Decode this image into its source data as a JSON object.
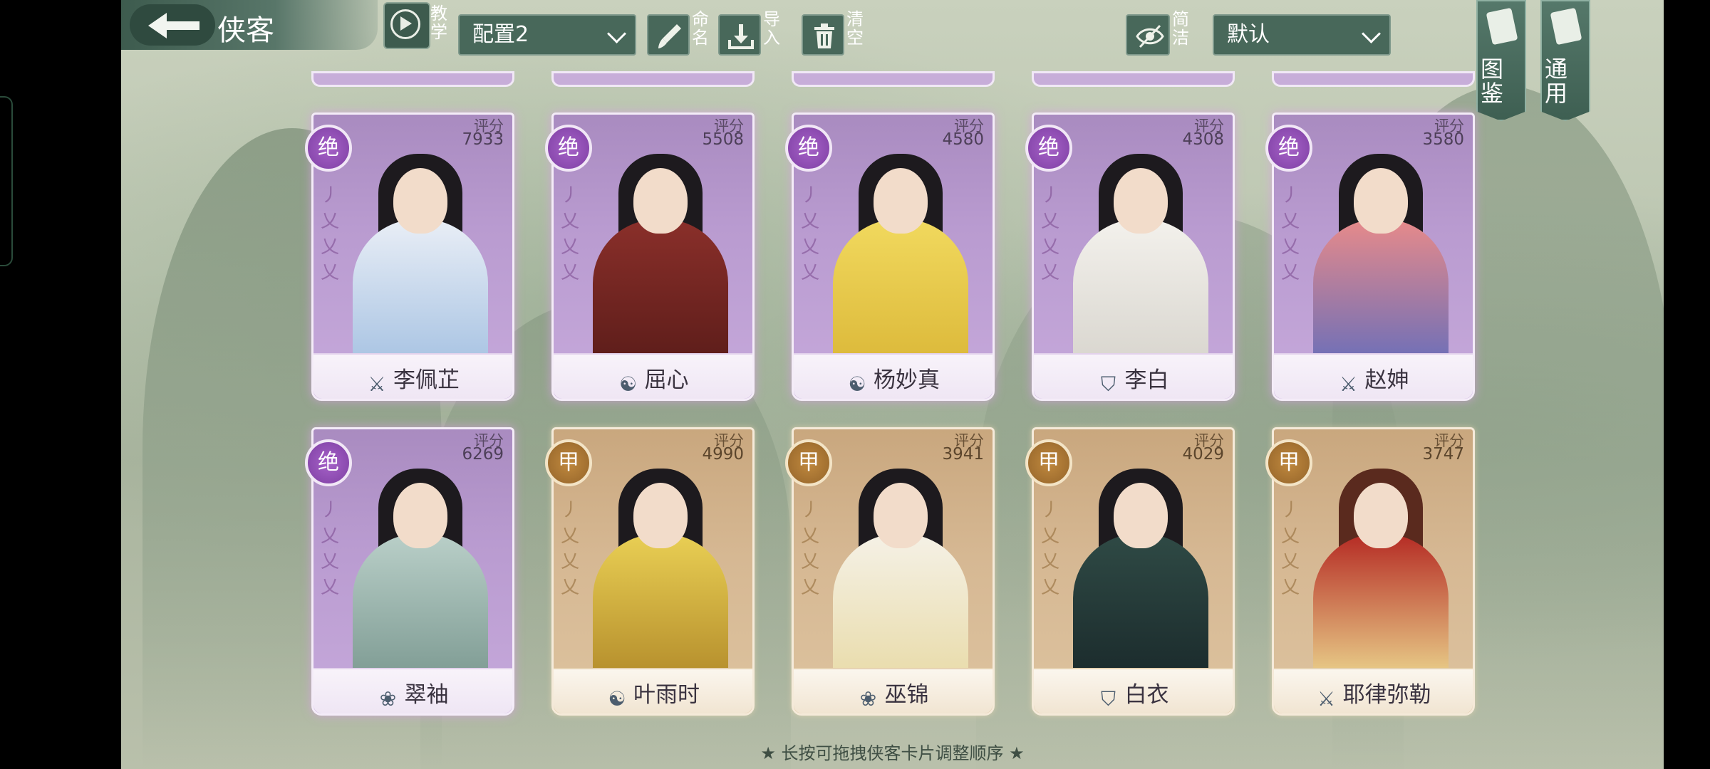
{
  "header": {
    "title": "侠客",
    "tutorial_label": "教学",
    "preset_value": "配置2",
    "rename_label": "命名",
    "import_label": "导入",
    "clear_label": "清空",
    "simple_label": "简洁",
    "sort_value": "默认"
  },
  "side_tabs": [
    {
      "label": "图鉴"
    },
    {
      "label": "通用"
    }
  ],
  "cards": [
    {
      "rarity": "绝",
      "score_label": "评分",
      "score": "7933",
      "name": "李佩芷",
      "class_icon": "sword-icon"
    },
    {
      "rarity": "绝",
      "score_label": "评分",
      "score": "5508",
      "name": "屈心",
      "class_icon": "yinyang-icon"
    },
    {
      "rarity": "绝",
      "score_label": "评分",
      "score": "4580",
      "name": "杨妙真",
      "class_icon": "yinyang-icon"
    },
    {
      "rarity": "绝",
      "score_label": "评分",
      "score": "4308",
      "name": "李白",
      "class_icon": "shield-icon"
    },
    {
      "rarity": "绝",
      "score_label": "评分",
      "score": "3580",
      "name": "赵妽",
      "class_icon": "sword-icon"
    },
    {
      "rarity": "绝",
      "score_label": "评分",
      "score": "6269",
      "name": "翠袖",
      "class_icon": "lotus-icon"
    },
    {
      "rarity": "甲",
      "score_label": "评分",
      "score": "4990",
      "name": "叶雨时",
      "class_icon": "yinyang-icon"
    },
    {
      "rarity": "甲",
      "score_label": "评分",
      "score": "3941",
      "name": "巫锦",
      "class_icon": "lotus-icon"
    },
    {
      "rarity": "甲",
      "score_label": "评分",
      "score": "4029",
      "name": "白衣",
      "class_icon": "shield-icon"
    },
    {
      "rarity": "甲",
      "score_label": "评分",
      "score": "3747",
      "name": "耶律弥勒",
      "class_icon": "sword-icon"
    }
  ],
  "hint": "★ 长按可拖拽侠客卡片调整顺序 ★",
  "colors": {
    "jue_card": "#b99bd0",
    "jia_card": "#d6b893",
    "toolbar": "#48685a"
  }
}
